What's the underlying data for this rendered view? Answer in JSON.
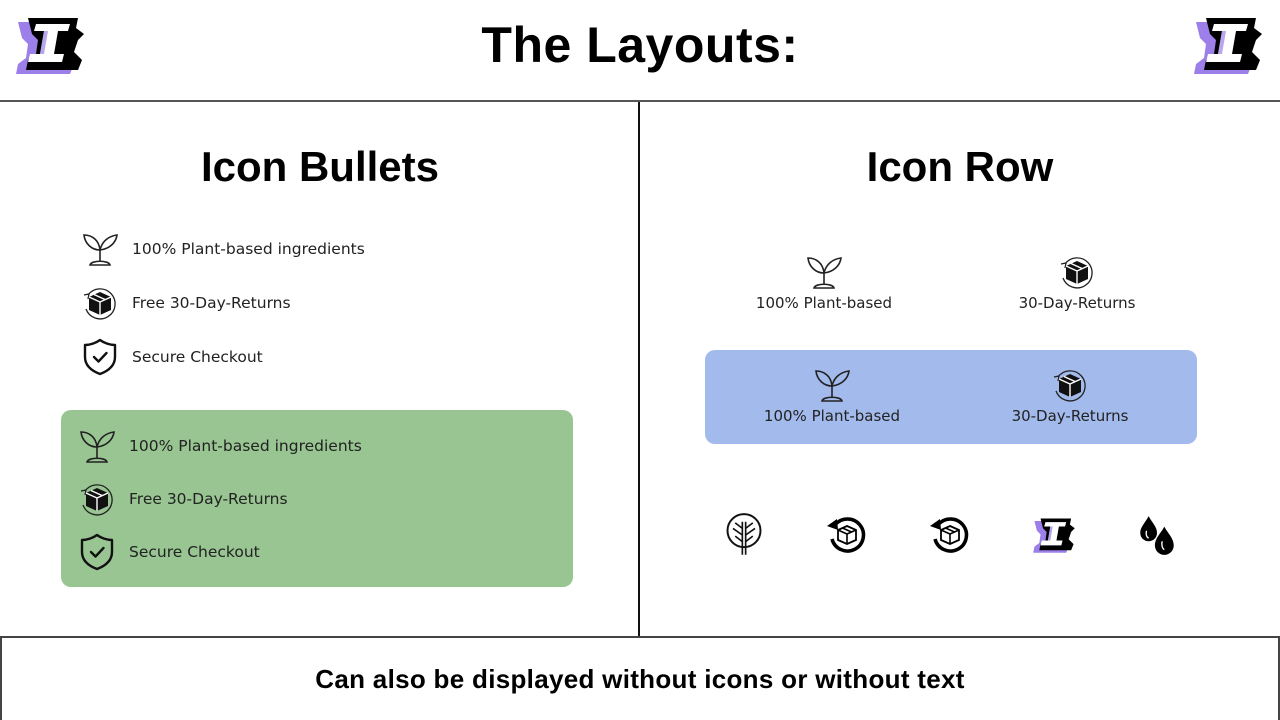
{
  "header": {
    "title": "The Layouts:",
    "logo_icon": "brand-i-logo-icon"
  },
  "colors": {
    "green_box": "#98c592",
    "blue_box": "#a3baec",
    "logo_purple": "#9c7fe8",
    "text": "#222222"
  },
  "icon_bullets": {
    "title": "Icon Bullets",
    "plain_items": [
      {
        "icon": "plant-sprout-icon",
        "label": "100% Plant-based ingredients"
      },
      {
        "icon": "box-return-icon",
        "label": "Free 30-Day-Returns"
      },
      {
        "icon": "shield-check-icon",
        "label": "Secure Checkout"
      }
    ],
    "boxed_items": [
      {
        "icon": "plant-sprout-icon",
        "label": "100% Plant-based ingredients"
      },
      {
        "icon": "box-return-icon",
        "label": "Free 30-Day-Returns"
      },
      {
        "icon": "shield-check-icon",
        "label": "Secure Checkout"
      }
    ]
  },
  "icon_row": {
    "title": "Icon Row",
    "plain_items": [
      {
        "icon": "plant-sprout-icon",
        "label": "100% Plant-based"
      },
      {
        "icon": "box-return-icon",
        "label": "30-Day-Returns"
      }
    ],
    "boxed_items": [
      {
        "icon": "plant-sprout-icon",
        "label": "100% Plant-based"
      },
      {
        "icon": "box-return-icon",
        "label": "30-Day-Returns"
      }
    ],
    "icon_only": [
      "tree-icon",
      "return-package-icon",
      "return-package-icon",
      "brand-i-logo-icon",
      "water-drops-icon"
    ]
  },
  "footer": {
    "text": "Can also be displayed without icons or without text"
  }
}
